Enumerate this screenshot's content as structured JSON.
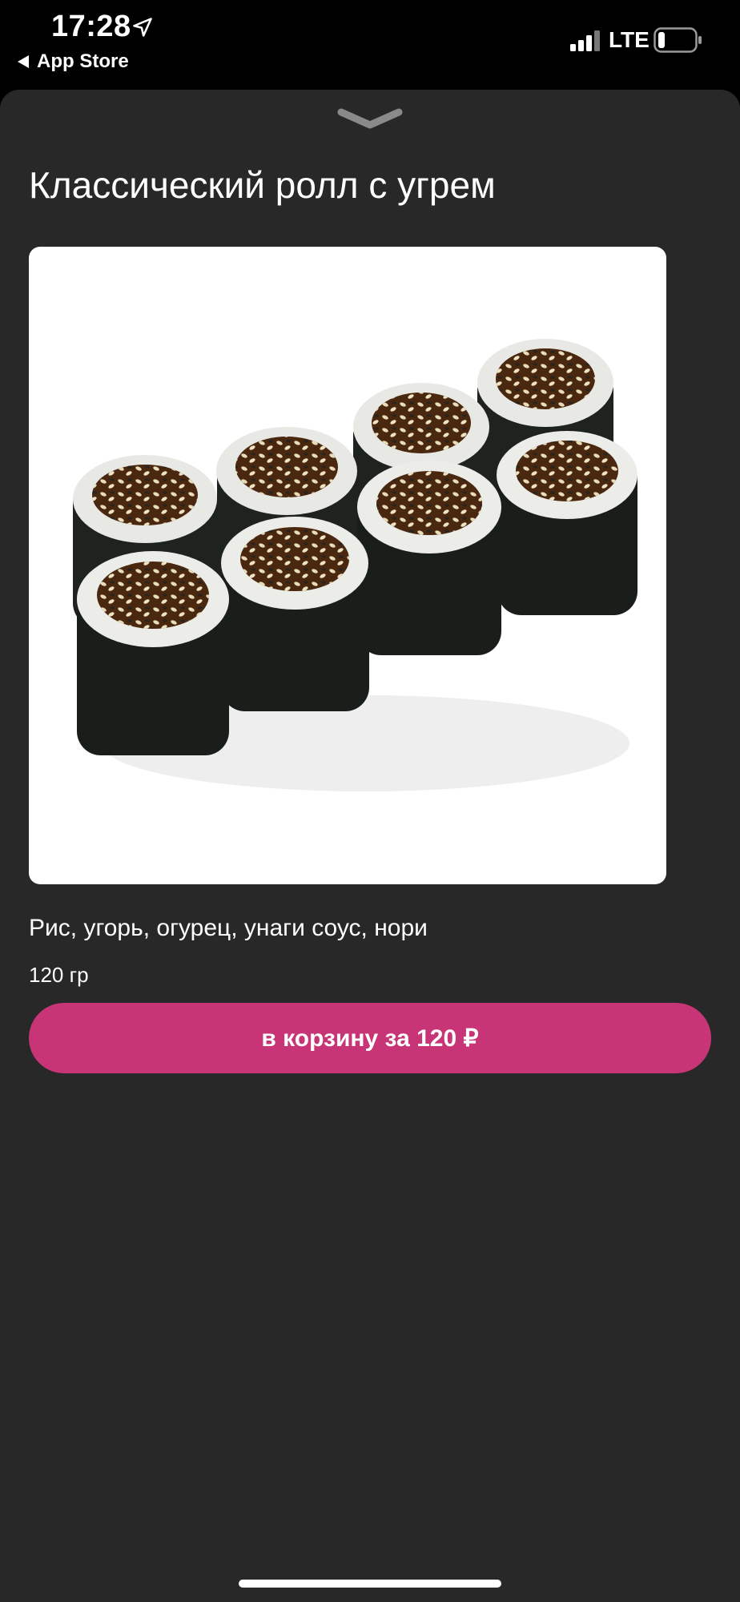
{
  "status_bar": {
    "time": "17:28",
    "back_label": "App Store",
    "network": "LTE",
    "location_icon": "location-arrow-icon",
    "signal_icon": "cellular-signal-icon",
    "battery_icon": "battery-low-icon"
  },
  "sheet": {
    "dismiss_icon": "chevron-down-icon",
    "title": "Классический ролл с угрем",
    "image_icon": "sushi-roll-photo",
    "ingredients": "Рис, угорь, огурец, унаги соус, нори",
    "weight": "120 гр",
    "add_to_cart_label": "в корзину за 120 ₽"
  },
  "colors": {
    "sheet_background": "#282828",
    "accent": "#c83577",
    "status_background": "#000000"
  }
}
